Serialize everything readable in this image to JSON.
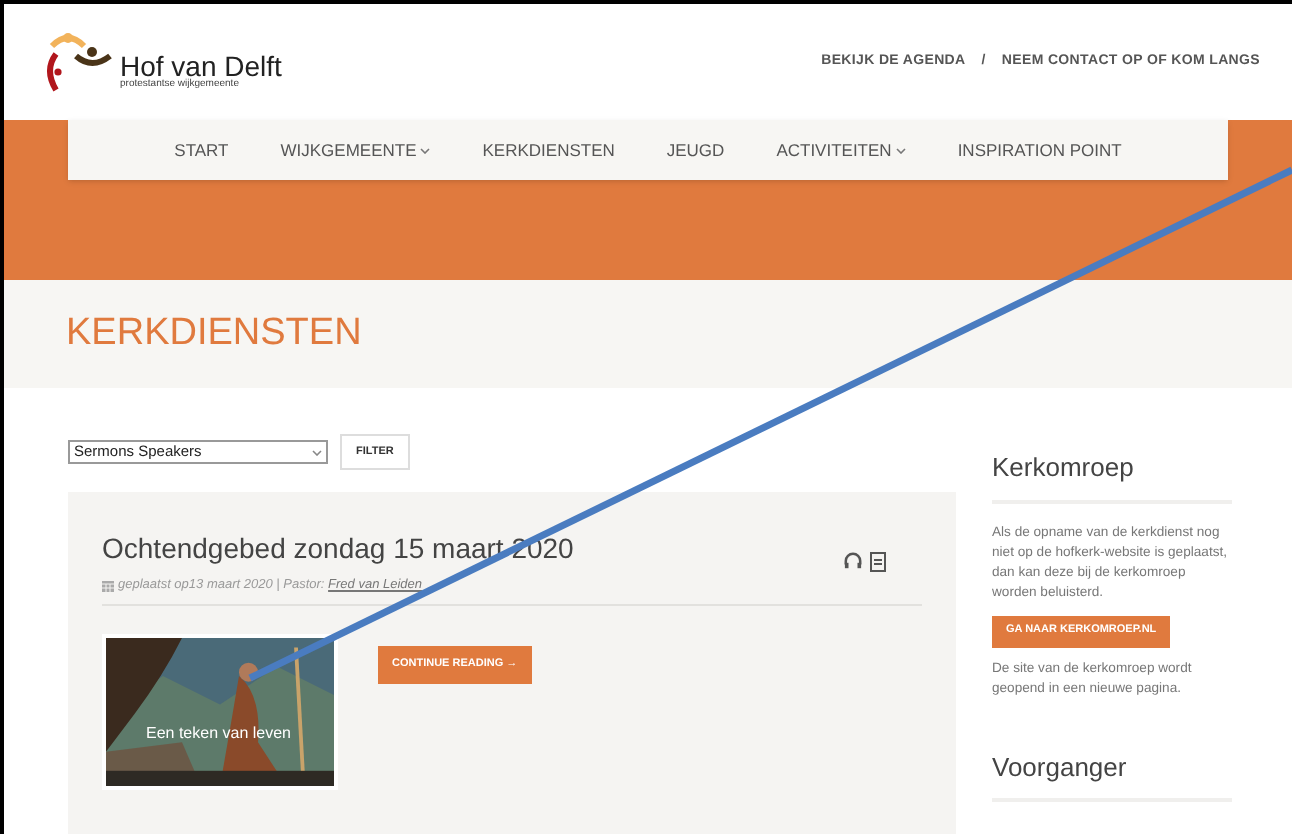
{
  "header": {
    "logo_title": "Hof van Delft",
    "logo_subtitle": "protestantse wijkgemeente",
    "top_links": [
      "BEKIJK DE AGENDA",
      "NEEM CONTACT OP OF KOM LANGS"
    ],
    "separator": "/"
  },
  "nav": [
    {
      "label": "START",
      "dropdown": false
    },
    {
      "label": "WIJKGEMEENTE",
      "dropdown": true
    },
    {
      "label": "KERKDIENSTEN",
      "dropdown": false
    },
    {
      "label": "JEUGD",
      "dropdown": false
    },
    {
      "label": "ACTIVITEITEN",
      "dropdown": true
    },
    {
      "label": "INSPIRATION POINT",
      "dropdown": false
    }
  ],
  "page_title": "KERKDIENSTEN",
  "filter": {
    "select_value": "Sermons Speakers",
    "button": "FILTER"
  },
  "sermon": {
    "title": "Ochtendgebed zondag 15 maart 2020",
    "meta": "geplaatst op13 maart 2020 | Pastor: ",
    "pastor": "Fred van Leiden",
    "thumbnail": {
      "kind": "picture",
      "caption": "Een teken van leven"
    },
    "button": "CONTINUE READING →"
  },
  "sidebar": {
    "sections": [
      {
        "title": "Kerkomroep",
        "text": "Als de opname van de kerkdienst nog niet op de hofkerk-website is geplaatst, dan kan deze bij de kerkomroep worden beluisterd.",
        "button": "GA NAAR KERKOMROEP.NL",
        "note": "De site van de kerkomroep wordt geopend in een nieuwe pagina."
      },
      {
        "title": "Voorganger"
      }
    ]
  }
}
